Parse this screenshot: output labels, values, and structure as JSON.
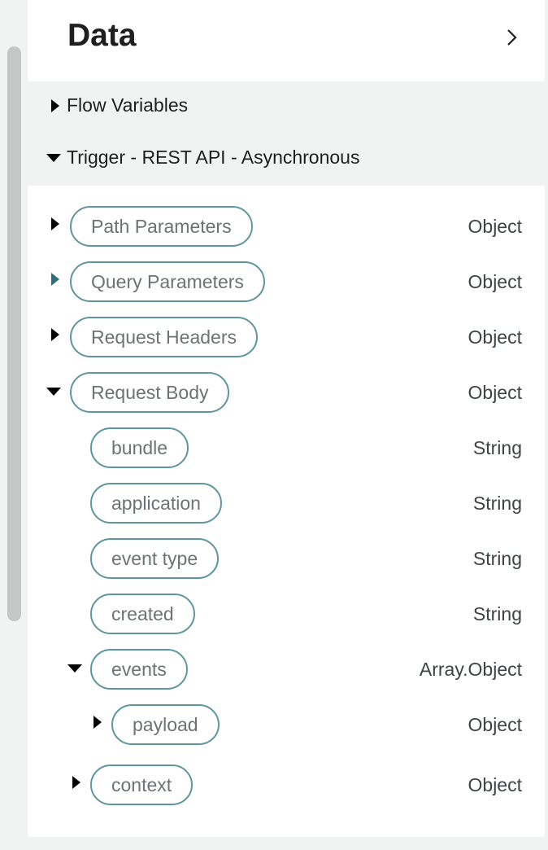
{
  "panel": {
    "title": "Data"
  },
  "groups": {
    "flow_variables": "Flow Variables",
    "trigger": "Trigger - REST API - Asynchronous"
  },
  "fields": {
    "path_parameters": {
      "label": "Path Parameters",
      "type": "Object"
    },
    "query_parameters": {
      "label": "Query Parameters",
      "type": "Object"
    },
    "request_headers": {
      "label": "Request Headers",
      "type": "Object"
    },
    "request_body": {
      "label": "Request Body",
      "type": "Object"
    },
    "bundle": {
      "label": "bundle",
      "type": "String"
    },
    "application": {
      "label": "application",
      "type": "String"
    },
    "event_type": {
      "label": "event type",
      "type": "String"
    },
    "created": {
      "label": "created",
      "type": "String"
    },
    "events": {
      "label": "events",
      "type": "Array.Object"
    },
    "payload": {
      "label": "payload",
      "type": "Object"
    },
    "context": {
      "label": "context",
      "type": "Object"
    }
  },
  "colors": {
    "pill_border": "#5e969f",
    "pill_text": "#6d7273",
    "accent_caret": "#2f6f7c"
  }
}
